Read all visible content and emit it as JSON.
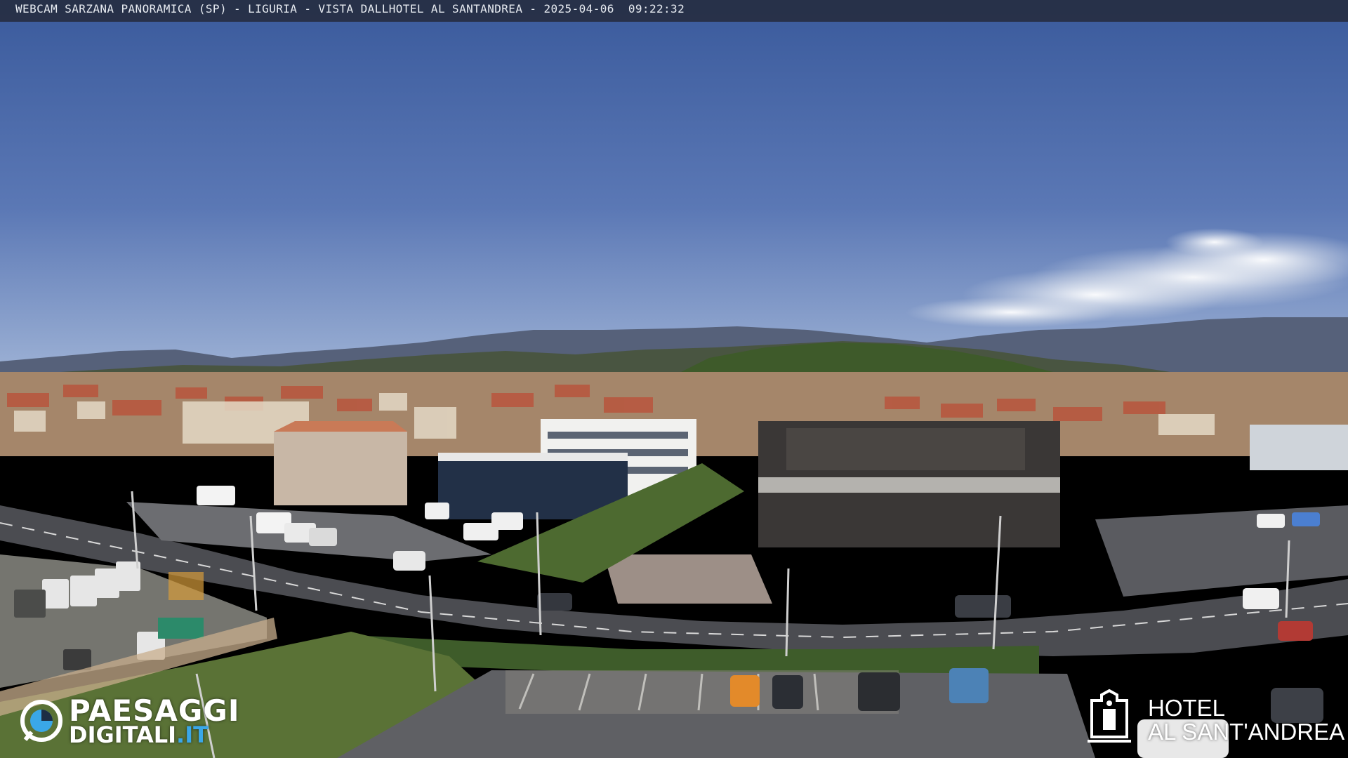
{
  "overlay": {
    "caption": "WEBCAM SARZANA PANORAMICA (SP) - LIGURIA - VISTA DALLHOTEL AL SANTANDREA - 2025-04-06  09:22:32"
  },
  "logo_left": {
    "line1": "PAESAGGI",
    "line2_main": "DIGITALI",
    "line2_suffix": ".IT"
  },
  "logo_right": {
    "line1": "HOTEL",
    "line2": "AL SANT'ANDREA"
  },
  "scene": {
    "description_icon": "webcam-landscape",
    "colors": {
      "sky_top": "#3e5d9e",
      "sky_bottom": "#8ea7cf",
      "mountains": "#4d5868",
      "hills_green": "#3f5a2e",
      "road": "#4a4b50",
      "parking": "#76767a",
      "grass": "#566b34"
    }
  }
}
